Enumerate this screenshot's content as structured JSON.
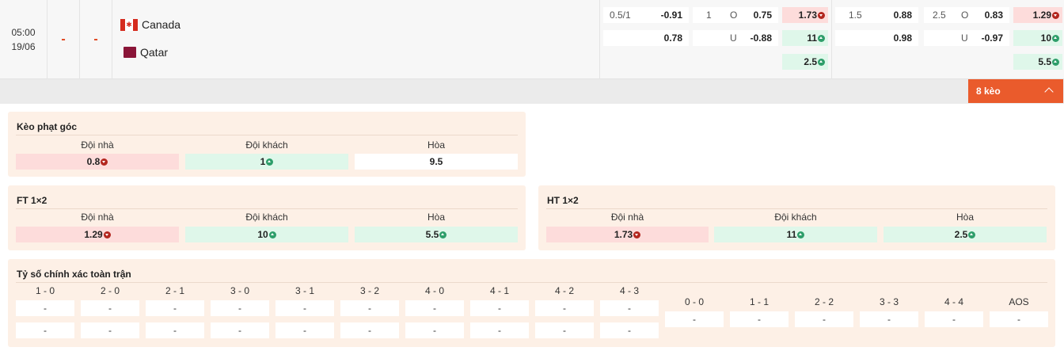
{
  "match": {
    "time": "05:00",
    "date": "19/06",
    "score_home": "-",
    "score_away": "-",
    "home_team": "Canada",
    "away_team": "Qatar"
  },
  "odds": {
    "ft_handicap": {
      "line": "0.5/1",
      "home": "-0.91",
      "away": "0.78"
    },
    "ft_overunder": {
      "line": "1",
      "over_label": "O",
      "over": "0.75",
      "under_label": "U",
      "under": "-0.88"
    },
    "ft_1x2": {
      "home": "1.73",
      "away": "11",
      "draw": "2.5"
    },
    "h1_handicap": {
      "line": "1.5",
      "home": "0.88",
      "away": "0.98"
    },
    "h1_overunder": {
      "line": "2.5",
      "over_label": "O",
      "over": "0.83",
      "under_label": "U",
      "under": "-0.97"
    },
    "h1_1x2": {
      "home": "1.29",
      "away": "10",
      "draw": "5.5"
    }
  },
  "more_button": {
    "label": "8 kèo"
  },
  "corner": {
    "title": "Kèo phạt góc",
    "labels": [
      "Đội nhà",
      "Đội khách",
      "Hòa"
    ],
    "values": [
      "0.8",
      "1",
      "9.5"
    ]
  },
  "ft": {
    "title": "FT 1×2",
    "labels": [
      "Đội nhà",
      "Đội khách",
      "Hòa"
    ],
    "values": [
      "1.29",
      "10",
      "5.5"
    ]
  },
  "ht": {
    "title": "HT 1×2",
    "labels": [
      "Đội nhà",
      "Đội khách",
      "Hòa"
    ],
    "values": [
      "1.73",
      "11",
      "2.5"
    ]
  },
  "correct_score": {
    "title": "Tỷ số chính xác toàn trận",
    "home_wins": [
      {
        "score": "1 - 0",
        "odds_home": "-",
        "odds_away": "-"
      },
      {
        "score": "2 - 0",
        "odds_home": "-",
        "odds_away": "-"
      },
      {
        "score": "2 - 1",
        "odds_home": "-",
        "odds_away": "-"
      },
      {
        "score": "3 - 0",
        "odds_home": "-",
        "odds_away": "-"
      },
      {
        "score": "3 - 1",
        "odds_home": "-",
        "odds_away": "-"
      },
      {
        "score": "3 - 2",
        "odds_home": "-",
        "odds_away": "-"
      },
      {
        "score": "4 - 0",
        "odds_home": "-",
        "odds_away": "-"
      },
      {
        "score": "4 - 1",
        "odds_home": "-",
        "odds_away": "-"
      },
      {
        "score": "4 - 2",
        "odds_home": "-",
        "odds_away": "-"
      },
      {
        "score": "4 - 3",
        "odds_home": "-",
        "odds_away": "-"
      }
    ],
    "draws": [
      {
        "score": "0 - 0",
        "odds": "-"
      },
      {
        "score": "1 - 1",
        "odds": "-"
      },
      {
        "score": "2 - 2",
        "odds": "-"
      },
      {
        "score": "3 - 3",
        "odds": "-"
      },
      {
        "score": "4 - 4",
        "odds": "-"
      },
      {
        "score": "AOS",
        "odds": "-"
      }
    ]
  },
  "colors": {
    "accent": "#ea5b2c",
    "score_dash": "#e0421b",
    "panel_bg": "#fdf0e6",
    "odds_down_bg": "#fddcdb",
    "odds_up_bg": "#dff7ea"
  }
}
